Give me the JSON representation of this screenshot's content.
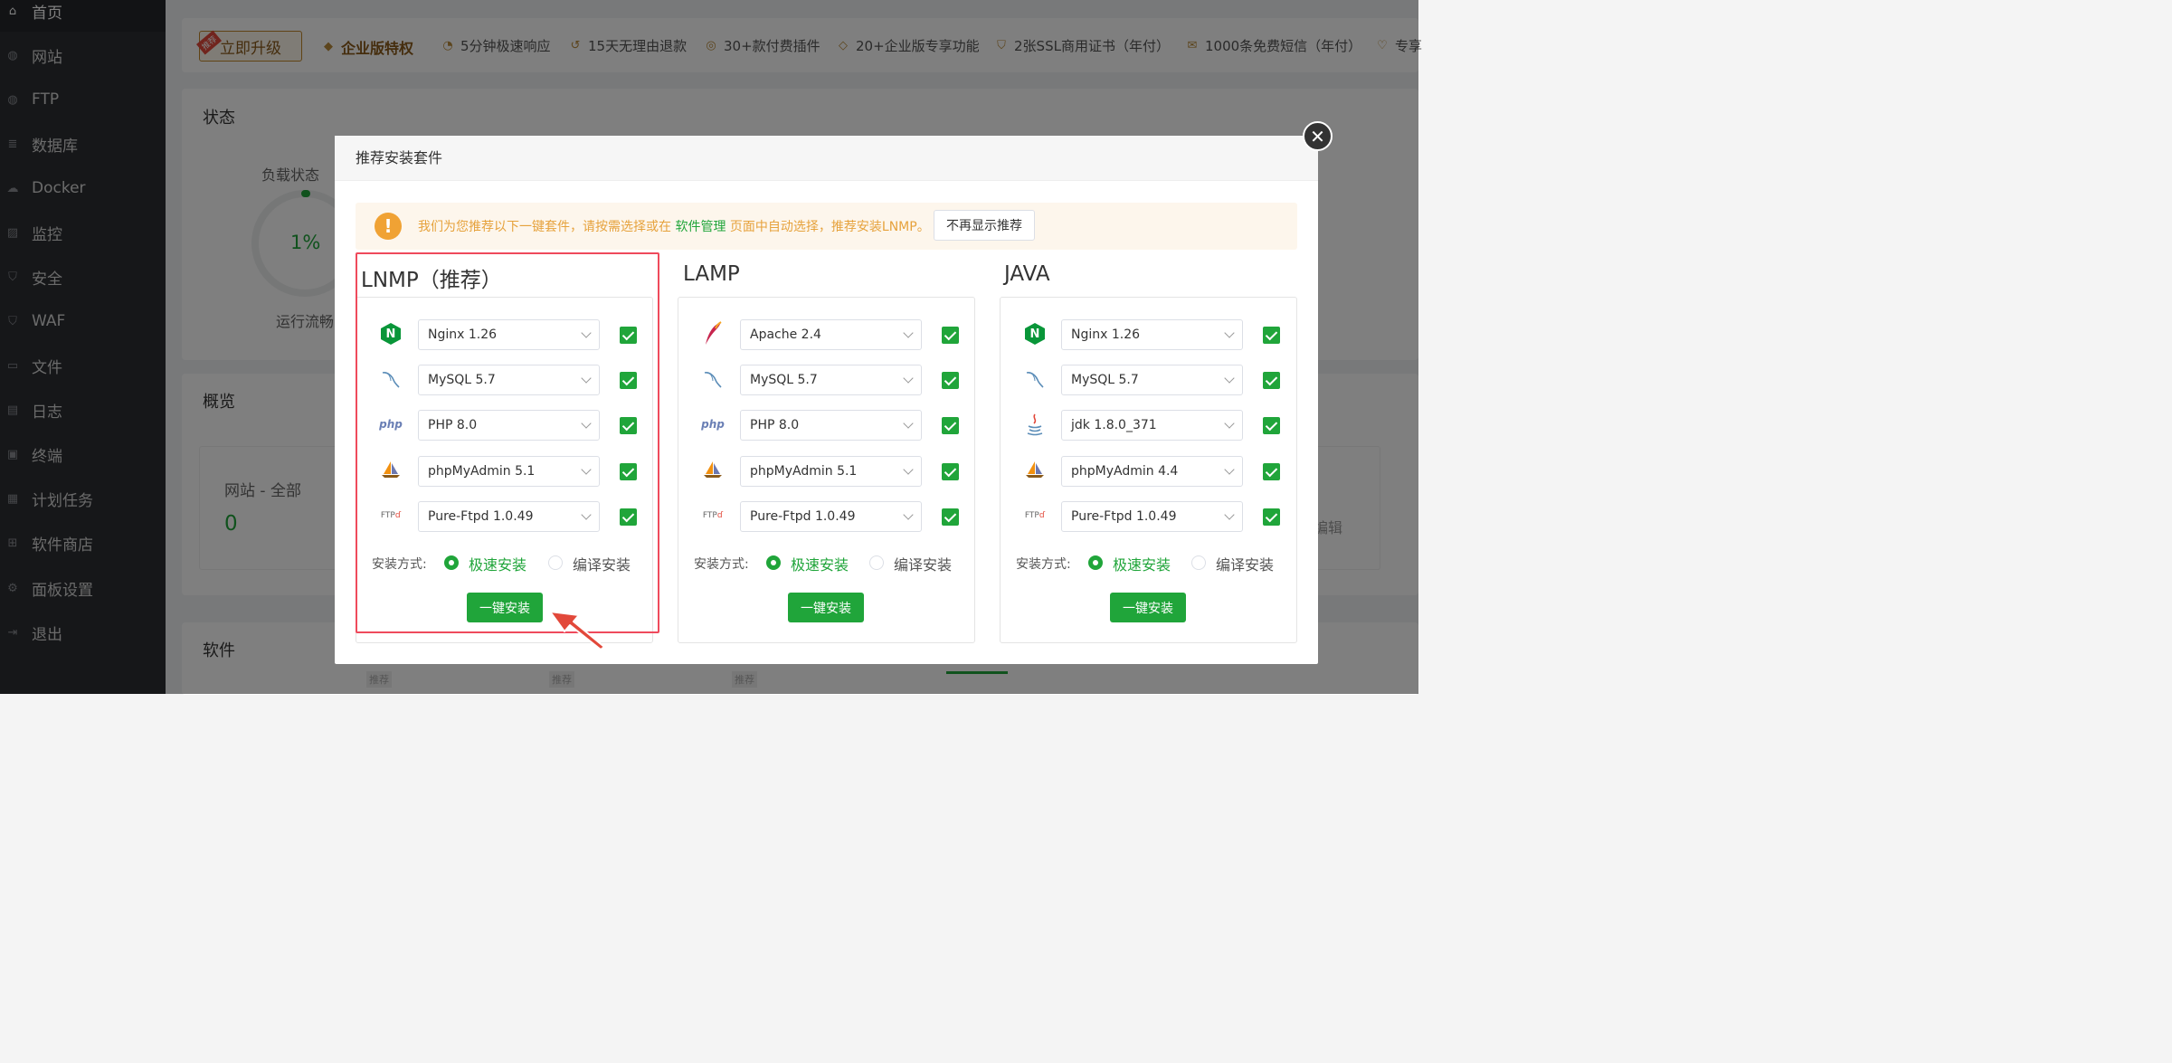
{
  "sidebar": {
    "items": [
      {
        "label": "首页",
        "icon": "home-icon"
      },
      {
        "label": "网站",
        "icon": "globe-icon"
      },
      {
        "label": "FTP",
        "icon": "globe-icon"
      },
      {
        "label": "数据库",
        "icon": "database-icon"
      },
      {
        "label": "Docker",
        "icon": "docker-icon"
      },
      {
        "label": "监控",
        "icon": "monitor-icon"
      },
      {
        "label": "安全",
        "icon": "shield-icon"
      },
      {
        "label": "WAF",
        "icon": "shield-icon"
      },
      {
        "label": "文件",
        "icon": "folder-icon"
      },
      {
        "label": "日志",
        "icon": "log-icon"
      },
      {
        "label": "终端",
        "icon": "terminal-icon"
      },
      {
        "label": "计划任务",
        "icon": "calendar-icon"
      },
      {
        "label": "软件商店",
        "icon": "apps-icon"
      },
      {
        "label": "面板设置",
        "icon": "gear-icon"
      },
      {
        "label": "退出",
        "icon": "logout-icon"
      }
    ]
  },
  "upgrade": {
    "tag": "推荐",
    "button": "立即升级",
    "enterprise": "企业版特权",
    "features": [
      "5分钟极速响应",
      "15天无理由退款",
      "30+款付费插件",
      "20+企业版专享功能",
      "2张SSL商用证书（年付）",
      "1000条免费短信（年付）",
      "专享"
    ]
  },
  "background": {
    "status_title": "状态",
    "load_label": "负载状态",
    "load_value": "1%",
    "load_status": "运行流畅",
    "overview_title": "概览",
    "site_label": "网站 - 全部",
    "site_count": "0",
    "edit_text": "编辑",
    "software_title": "软件",
    "rec_tags": [
      "推荐",
      "推荐",
      "推荐"
    ]
  },
  "dialog": {
    "title": "推荐安装套件",
    "notice_before": "我们为您推荐以下一键套件，请按需选择或在",
    "notice_link": "软件管理",
    "notice_after": "页面中自动选择，推荐安装LNMP。",
    "dismiss": "不再显示推荐",
    "method_label": "安装方式:",
    "fast": "极速安装",
    "compile": "编译安装",
    "install": "一键安装",
    "columns": [
      {
        "title": "LNMP（推荐）",
        "rows": [
          {
            "icon": "nginx-icon",
            "value": "Nginx 1.26"
          },
          {
            "icon": "mysql-icon",
            "value": "MySQL 5.7"
          },
          {
            "icon": "php-icon",
            "value": "PHP 8.0"
          },
          {
            "icon": "phpmyadmin-icon",
            "value": "phpMyAdmin 5.1"
          },
          {
            "icon": "ftp-icon",
            "value": "Pure-Ftpd 1.0.49"
          }
        ]
      },
      {
        "title": "LAMP",
        "rows": [
          {
            "icon": "apache-icon",
            "value": "Apache 2.4"
          },
          {
            "icon": "mysql-icon",
            "value": "MySQL 5.7"
          },
          {
            "icon": "php-icon",
            "value": "PHP 8.0"
          },
          {
            "icon": "phpmyadmin-icon",
            "value": "phpMyAdmin 5.1"
          },
          {
            "icon": "ftp-icon",
            "value": "Pure-Ftpd 1.0.49"
          }
        ]
      },
      {
        "title": "JAVA",
        "rows": [
          {
            "icon": "nginx-icon",
            "value": "Nginx 1.26"
          },
          {
            "icon": "mysql-icon",
            "value": "MySQL 5.7"
          },
          {
            "icon": "java-icon",
            "value": "jdk 1.8.0_371"
          },
          {
            "icon": "phpmyadmin-icon",
            "value": "phpMyAdmin 4.4"
          },
          {
            "icon": "ftp-icon",
            "value": "Pure-Ftpd 1.0.49"
          }
        ]
      }
    ]
  },
  "colors": {
    "accent": "#20a53a",
    "warning": "#e6a23c",
    "highlight": "#ef4a5c",
    "sidebar": "#2d2f33"
  }
}
